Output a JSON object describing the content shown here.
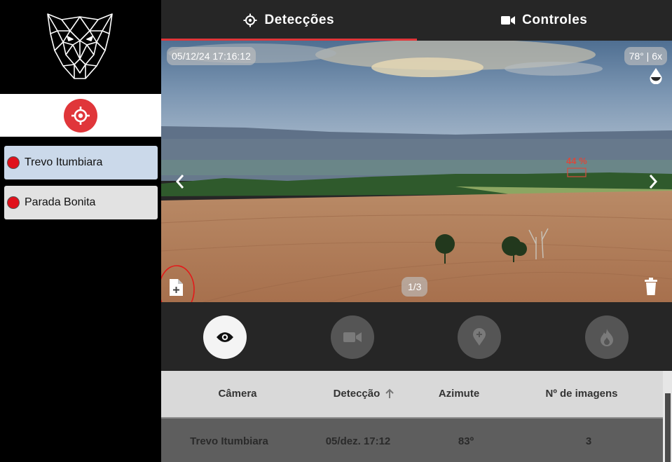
{
  "sidebar": {
    "cameras": [
      {
        "label": "Trevo Itumbiara",
        "status_color": "#e0111b",
        "selected": true
      },
      {
        "label": "Parada Bonita",
        "status_color": "#e0111b",
        "selected": false
      }
    ]
  },
  "tabs": [
    {
      "label": "Detecções",
      "icon": "crosshair-icon",
      "active": true
    },
    {
      "label": "Controles",
      "icon": "video-camera-icon",
      "active": false
    }
  ],
  "viewer": {
    "timestamp": "05/12/24 17:16:12",
    "azimuth_zoom": "78° | 6x",
    "detection_label": "44 %",
    "page_indicator": "1/3"
  },
  "actions": [
    {
      "name": "eye-icon",
      "active": true
    },
    {
      "name": "video-camera-icon",
      "active": false
    },
    {
      "name": "map-pin-icon",
      "active": false
    },
    {
      "name": "fire-icon",
      "active": false
    }
  ],
  "table": {
    "headers": [
      "Câmera",
      "Detecção",
      "Azimute",
      "Nº de imagens"
    ],
    "sort_icon": "arrow-up-icon",
    "rows": [
      [
        "Trevo Itumbiara",
        "05/dez. 17:12",
        "83º",
        "3"
      ]
    ]
  },
  "colors": {
    "accent_red": "#e0363a",
    "selected_item": "#cbd9ea",
    "panel_dark": "#262626"
  }
}
